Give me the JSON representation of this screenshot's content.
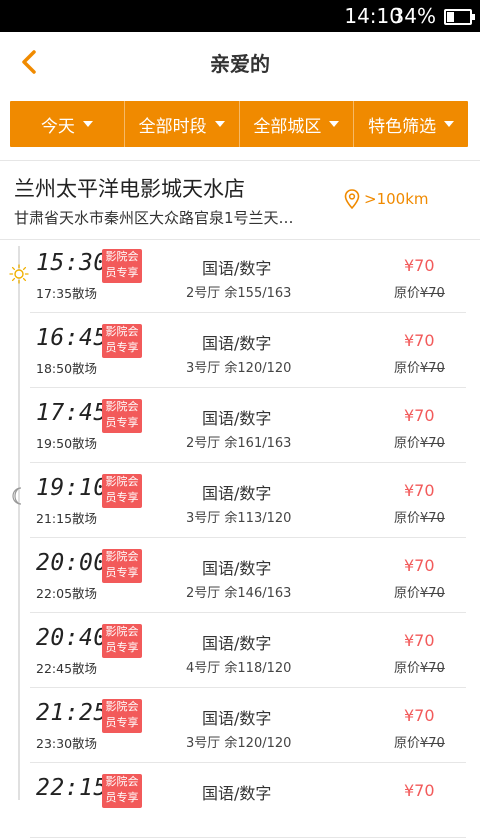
{
  "status_bar": {
    "time": "14:10",
    "battery": "34%",
    "battery_level": 0.34
  },
  "header": {
    "title": "亲爱的"
  },
  "filters": [
    {
      "label": "今天"
    },
    {
      "label": "全部时段"
    },
    {
      "label": "全部城区"
    },
    {
      "label": "特色筛选"
    }
  ],
  "cinema": {
    "name": "兰州太平洋电影城天水店",
    "address": "甘肃省天水市秦州区大众路官泉1号兰天…",
    "distance": ">100km"
  },
  "colors": {
    "accent": "#f08a00",
    "price": "#f25a5a"
  },
  "badge_text": "影院会员专享",
  "showtimes": [
    {
      "start": "15:30",
      "end": "17:35散场",
      "lang": "国语/数字",
      "hall": "2号厅  余155/163",
      "price": "¥70",
      "orig_prefix": "原价",
      "orig_value": "¥70"
    },
    {
      "start": "16:45",
      "end": "18:50散场",
      "lang": "国语/数字",
      "hall": "3号厅  余120/120",
      "price": "¥70",
      "orig_prefix": "原价",
      "orig_value": "¥70"
    },
    {
      "start": "17:45",
      "end": "19:50散场",
      "lang": "国语/数字",
      "hall": "2号厅  余161/163",
      "price": "¥70",
      "orig_prefix": "原价",
      "orig_value": "¥70"
    },
    {
      "start": "19:10",
      "end": "21:15散场",
      "lang": "国语/数字",
      "hall": "3号厅  余113/120",
      "price": "¥70",
      "orig_prefix": "原价",
      "orig_value": "¥70"
    },
    {
      "start": "20:00",
      "end": "22:05散场",
      "lang": "国语/数字",
      "hall": "2号厅  余146/163",
      "price": "¥70",
      "orig_prefix": "原价",
      "orig_value": "¥70"
    },
    {
      "start": "20:40",
      "end": "22:45散场",
      "lang": "国语/数字",
      "hall": "4号厅  余118/120",
      "price": "¥70",
      "orig_prefix": "原价",
      "orig_value": "¥70"
    },
    {
      "start": "21:25",
      "end": "23:30散场",
      "lang": "国语/数字",
      "hall": "3号厅  余120/120",
      "price": "¥70",
      "orig_prefix": "原价",
      "orig_value": "¥70"
    },
    {
      "start": "22:15",
      "end": "",
      "lang": "国语/数字",
      "hall": "",
      "price": "¥70",
      "orig_prefix": "",
      "orig_value": ""
    }
  ]
}
